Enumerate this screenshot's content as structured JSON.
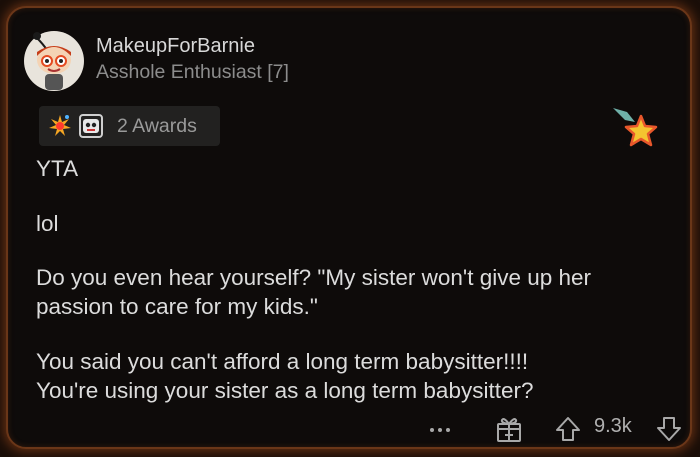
{
  "post": {
    "username": "MakeupForBarnie",
    "flair": "Asshole Enthusiast [7]",
    "awards_label": "2 Awards",
    "paragraphs": [
      "YTA",
      "lol",
      "Do you even hear yourself? \"My sister won't give up her",
      "passion to care for my kids.\"",
      "You said you can't afford a long term babysitter!!!!",
      "You're using your sister as a long term babysitter?"
    ],
    "score": "9.3k"
  },
  "icons": {
    "avatar": "snoo-avatar",
    "award1": "explosion-award-icon",
    "award2": "robot-award-icon",
    "star_award": "falling-star-icon",
    "more": "more-dots-icon",
    "save": "gift-icon",
    "upvote": "upvote-arrow-icon",
    "downvote": "downvote-arrow-icon"
  },
  "colors": {
    "border_glow": "#6a3618",
    "background": "#0e0b0a",
    "text": "#dcdcdc",
    "muted": "#8c8c8c"
  }
}
